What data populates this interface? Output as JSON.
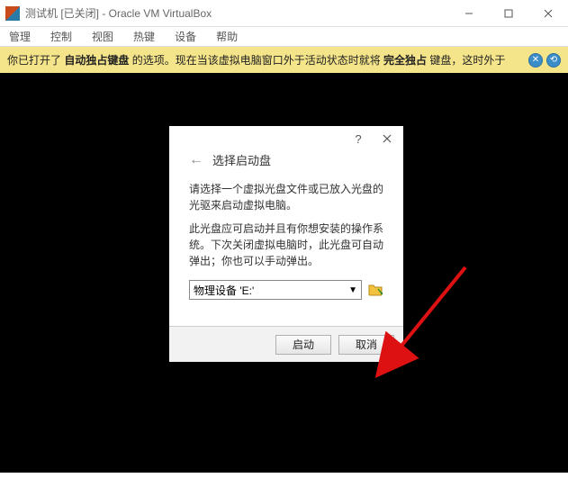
{
  "window": {
    "title": "测试机 [已关闭] - Oracle VM VirtualBox",
    "menus": [
      "管理",
      "控制",
      "视图",
      "热键",
      "设备",
      "帮助"
    ]
  },
  "notice": {
    "pre": "你已打开了 ",
    "b1": "自动独占键盘",
    "mid1": " 的选项。现在当该虚拟电脑窗口外于活动状态时就将 ",
    "b2": "完全独占",
    "mid2": " 键盘，这时外于"
  },
  "dialog": {
    "title": "选择启动盘",
    "para1": "请选择一个虚拟光盘文件或已放入光盘的光驱来启动虚拟电脑。",
    "para2": "此光盘应可启动并且有你想安装的操作系统。下次关闭虚拟电脑时，此光盘可自动弹出；你也可以手动弹出。",
    "drive_value": "物理设备 'E:'",
    "buttons": {
      "start": "启动",
      "cancel": "取消"
    }
  }
}
